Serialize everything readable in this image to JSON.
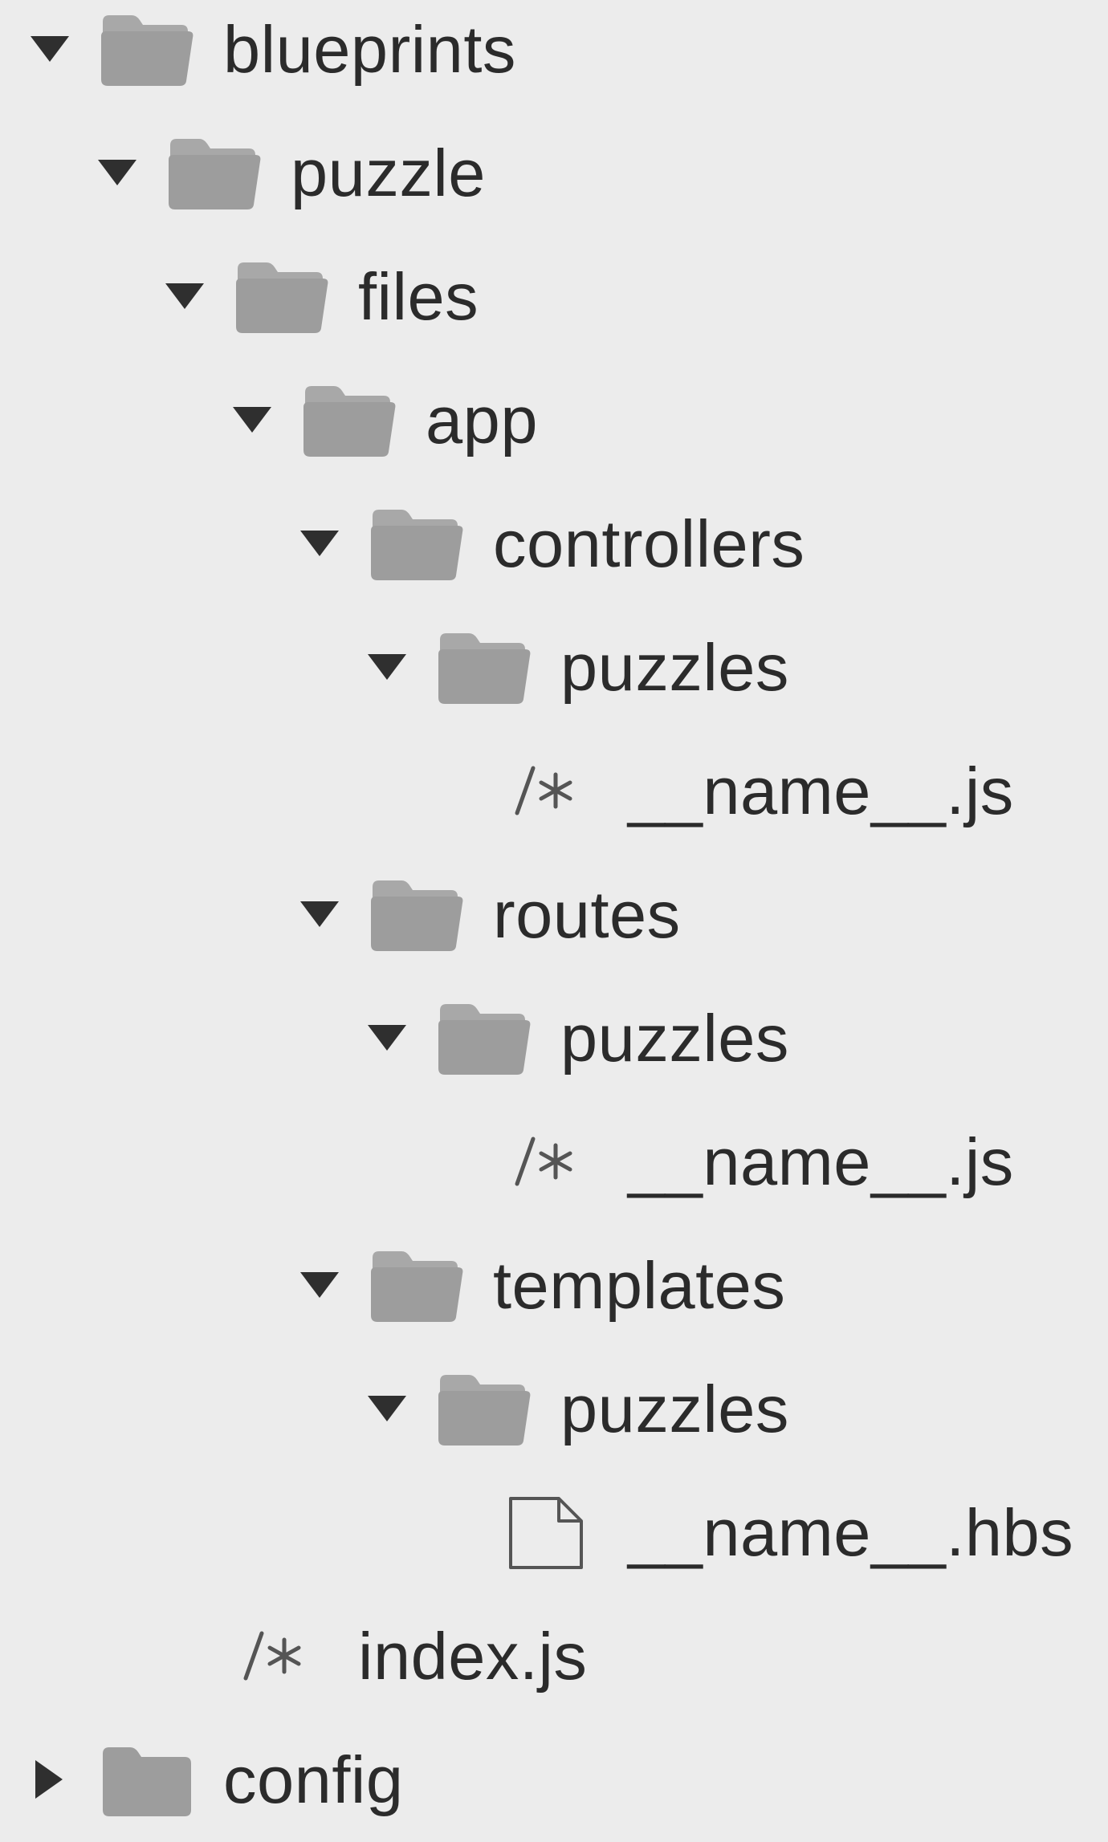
{
  "tree": [
    {
      "label": "blueprints",
      "type": "folder",
      "expanded": true,
      "icon": "folder-icon"
    },
    {
      "label": "puzzle",
      "type": "folder",
      "expanded": true,
      "icon": "folder-icon"
    },
    {
      "label": "files",
      "type": "folder",
      "expanded": true,
      "icon": "folder-icon"
    },
    {
      "label": "app",
      "type": "folder",
      "expanded": true,
      "icon": "folder-icon"
    },
    {
      "label": "controllers",
      "type": "folder",
      "expanded": true,
      "icon": "folder-icon"
    },
    {
      "label": "puzzles",
      "type": "folder",
      "expanded": true,
      "icon": "folder-icon"
    },
    {
      "label": "__name__.js",
      "type": "js-file",
      "icon": "js-file-icon"
    },
    {
      "label": "routes",
      "type": "folder",
      "expanded": true,
      "icon": "folder-icon"
    },
    {
      "label": "puzzles",
      "type": "folder",
      "expanded": true,
      "icon": "folder-icon"
    },
    {
      "label": "__name__.js",
      "type": "js-file",
      "icon": "js-file-icon"
    },
    {
      "label": "templates",
      "type": "folder",
      "expanded": true,
      "icon": "folder-icon"
    },
    {
      "label": "puzzles",
      "type": "folder",
      "expanded": true,
      "icon": "folder-icon"
    },
    {
      "label": "__name__.hbs",
      "type": "file",
      "icon": "document-icon"
    },
    {
      "label": "index.js",
      "type": "js-file",
      "icon": "js-file-icon"
    },
    {
      "label": "config",
      "type": "folder",
      "expanded": false,
      "icon": "folder-icon"
    }
  ],
  "colors": {
    "background": "#ececec",
    "text": "#2b2b2b",
    "folder": "#9d9d9d",
    "folder_back": "#a8a8a8",
    "disclosure": "#2f2f2f",
    "file_icon": "#555555"
  }
}
